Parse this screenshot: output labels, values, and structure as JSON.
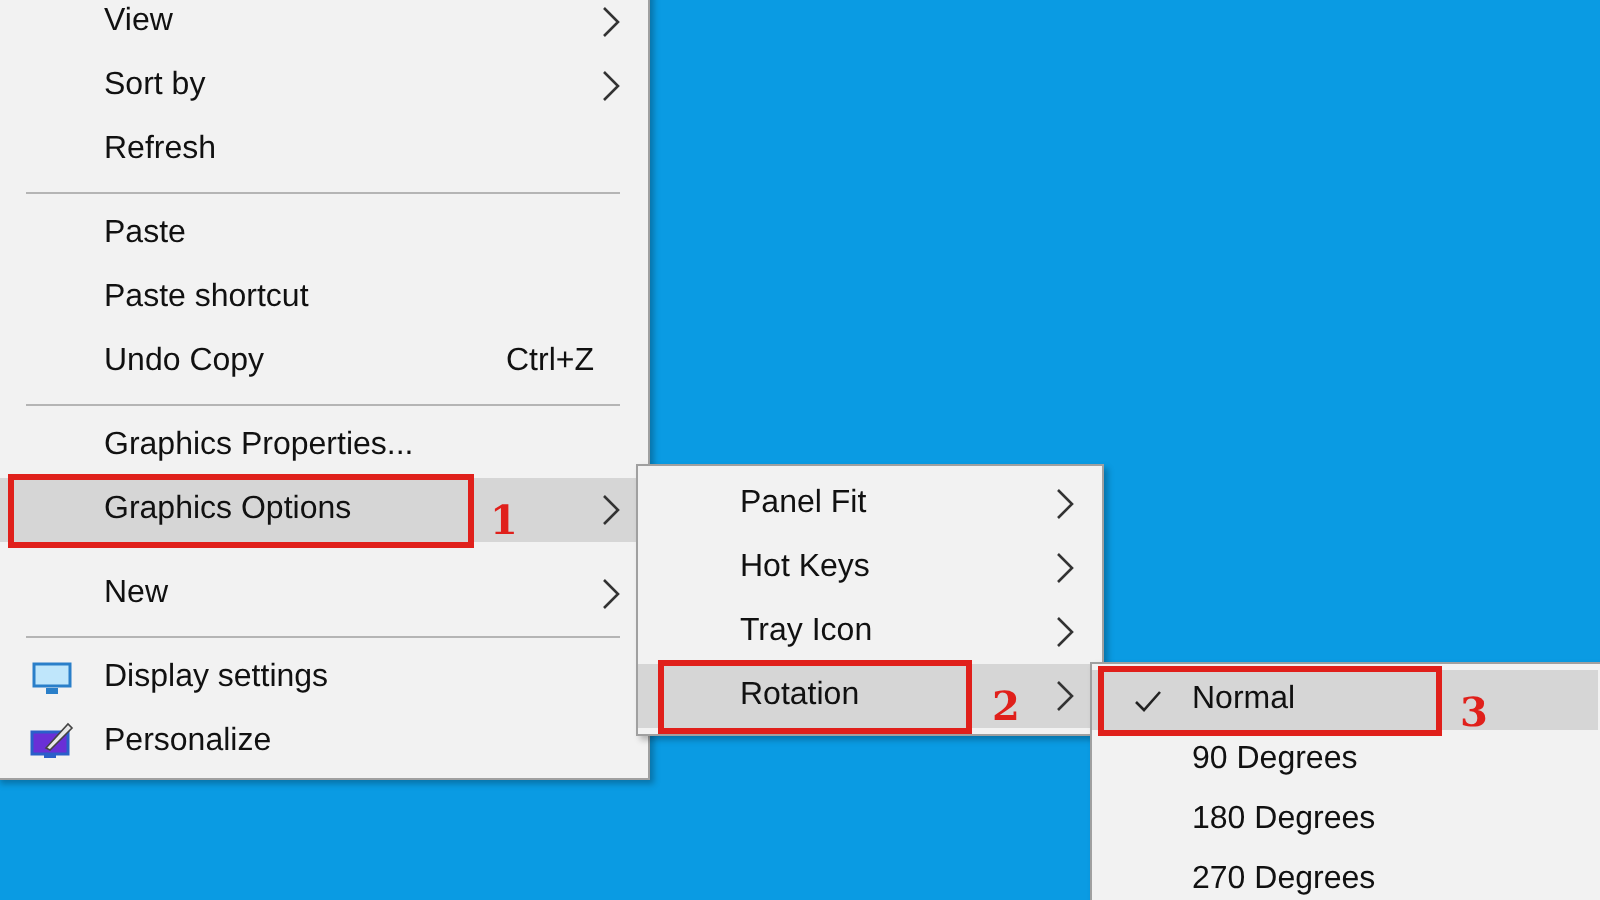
{
  "context_menu": {
    "items": [
      {
        "kind": "item",
        "label": "View",
        "submenu": true,
        "highlighted": false
      },
      {
        "kind": "item",
        "label": "Sort by",
        "submenu": true,
        "highlighted": false
      },
      {
        "kind": "item",
        "label": "Refresh",
        "submenu": false,
        "highlighted": false
      },
      {
        "kind": "separator"
      },
      {
        "kind": "item",
        "label": "Paste",
        "submenu": false,
        "highlighted": false
      },
      {
        "kind": "item",
        "label": "Paste shortcut",
        "submenu": false,
        "highlighted": false
      },
      {
        "kind": "item",
        "label": "Undo Copy",
        "shortcut": "Ctrl+Z",
        "submenu": false,
        "highlighted": false
      },
      {
        "kind": "separator"
      },
      {
        "kind": "item",
        "label": "Graphics Properties...",
        "submenu": false,
        "highlighted": false
      },
      {
        "kind": "item",
        "label": "Graphics Options",
        "submenu": true,
        "highlighted": true,
        "callout": "1"
      },
      {
        "kind": "spacer"
      },
      {
        "kind": "item",
        "label": "New",
        "submenu": true,
        "highlighted": false
      },
      {
        "kind": "separator"
      },
      {
        "kind": "monitor",
        "label": "Display settings",
        "submenu": false,
        "highlighted": false
      },
      {
        "kind": "brush",
        "label": "Personalize",
        "submenu": false,
        "highlighted": false
      }
    ]
  },
  "graphics_options_menu": {
    "items": [
      {
        "label": "Panel Fit",
        "submenu": true,
        "highlighted": false
      },
      {
        "label": "Hot Keys",
        "submenu": true,
        "highlighted": false
      },
      {
        "label": "Tray Icon",
        "submenu": true,
        "highlighted": false
      },
      {
        "label": "Rotation",
        "submenu": true,
        "highlighted": true,
        "callout": "2"
      }
    ]
  },
  "rotation_menu": {
    "items": [
      {
        "label": "Normal",
        "checked": true,
        "highlighted": true,
        "callout": "3"
      },
      {
        "label": "90 Degrees",
        "checked": false,
        "highlighted": false
      },
      {
        "label": "180 Degrees",
        "checked": false,
        "highlighted": false
      },
      {
        "label": "270 Degrees",
        "checked": false,
        "highlighted": false
      }
    ]
  }
}
